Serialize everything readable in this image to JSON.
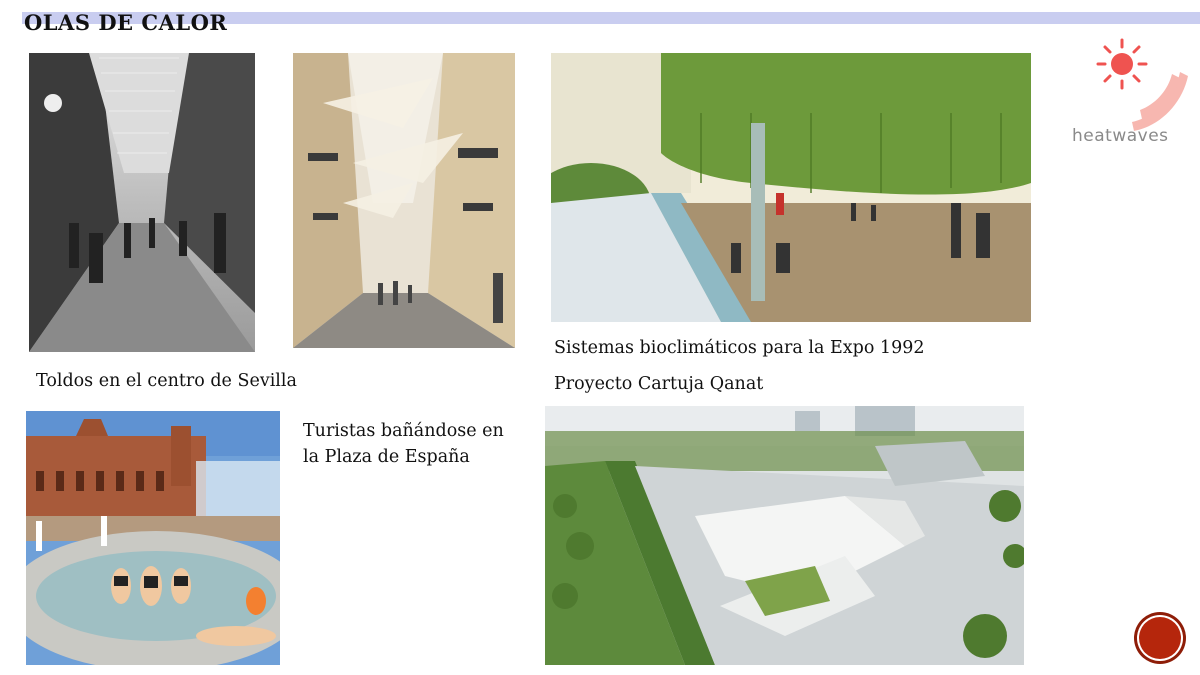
{
  "slide": {
    "title": "OLAS DE CALOR"
  },
  "logo": {
    "text": "heatwaves",
    "icon": "sun-icon",
    "colors": {
      "sun": "#ef5350",
      "wave": "#f7b7b0"
    }
  },
  "captions": {
    "toldos": "Toldos en el centro de Sevilla",
    "expo": "Sistemas bioclimáticos para la Expo 1992",
    "qanat": "Proyecto Cartuja Qanat",
    "turistas_line1": "Turistas bañándose en",
    "turistas_line2": "la Plaza de España"
  },
  "nav": {
    "icon": "next-slide-icon",
    "color": "#b5260c"
  }
}
